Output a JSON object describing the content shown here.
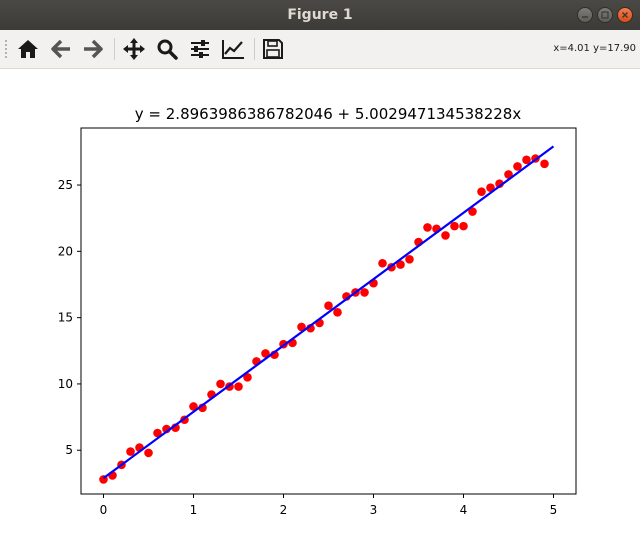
{
  "window": {
    "title": "Figure 1",
    "buttons": {
      "minimize_icon": "minimize-icon",
      "maximize_icon": "maximize-icon",
      "close_icon": "close-icon"
    }
  },
  "toolbar": {
    "items": [
      {
        "name": "home-button",
        "icon": "home-icon"
      },
      {
        "name": "back-button",
        "icon": "arrow-left-icon"
      },
      {
        "name": "forward-button",
        "icon": "arrow-right-icon"
      },
      {
        "name": "pan-button",
        "icon": "move-icon"
      },
      {
        "name": "zoom-button",
        "icon": "magnifier-icon"
      },
      {
        "name": "configure-subplots-button",
        "icon": "sliders-icon"
      },
      {
        "name": "edit-axis-button",
        "icon": "line-chart-icon"
      },
      {
        "name": "save-button",
        "icon": "floppy-disk-icon"
      }
    ],
    "coords": "x=4.01 y=17.90"
  },
  "chart_data": {
    "type": "scatter",
    "title": "y = 2.8963986386782046 + 5.002947134538228x",
    "xlabel": "",
    "ylabel": "",
    "xlim": [
      -0.25,
      5.25
    ],
    "ylim": [
      1.7,
      29.3
    ],
    "xticks": [
      0,
      1,
      2,
      3,
      4,
      5
    ],
    "yticks": [
      5,
      10,
      15,
      20,
      25
    ],
    "grid": false,
    "colors": {
      "points": "#ff0000",
      "line": "#0000ff"
    },
    "series": [
      {
        "kind": "scatter",
        "x": [
          0,
          0.1,
          0.2,
          0.3,
          0.4,
          0.5,
          0.6,
          0.7,
          0.8,
          0.9,
          1.0,
          1.1,
          1.2,
          1.3,
          1.4,
          1.5,
          1.6,
          1.7,
          1.8,
          1.9,
          2.0,
          2.1,
          2.2,
          2.3,
          2.4,
          2.5,
          2.6,
          2.7,
          2.8,
          2.9,
          3.0,
          3.1,
          3.2,
          3.3,
          3.4,
          3.5,
          3.6,
          3.7,
          3.8,
          3.9,
          4.0,
          4.1,
          4.2,
          4.3,
          4.4,
          4.5,
          4.6,
          4.7,
          4.8,
          4.9
        ],
        "y": [
          2.8,
          3.1,
          3.9,
          4.9,
          5.2,
          4.8,
          6.3,
          6.6,
          6.7,
          7.3,
          8.3,
          8.2,
          9.2,
          10.0,
          9.8,
          9.8,
          10.5,
          11.7,
          12.3,
          12.2,
          13.0,
          13.1,
          14.3,
          14.2,
          14.6,
          15.9,
          15.4,
          16.6,
          16.9,
          16.9,
          17.6,
          19.1,
          18.8,
          19.0,
          19.4,
          20.7,
          21.8,
          21.7,
          21.2,
          21.9,
          21.9,
          23.0,
          24.5,
          24.8,
          25.1,
          25.8,
          26.4,
          26.9,
          27.0,
          26.6
        ]
      },
      {
        "kind": "line",
        "x": [
          0,
          5
        ],
        "y": [
          2.896,
          27.911
        ]
      }
    ]
  }
}
